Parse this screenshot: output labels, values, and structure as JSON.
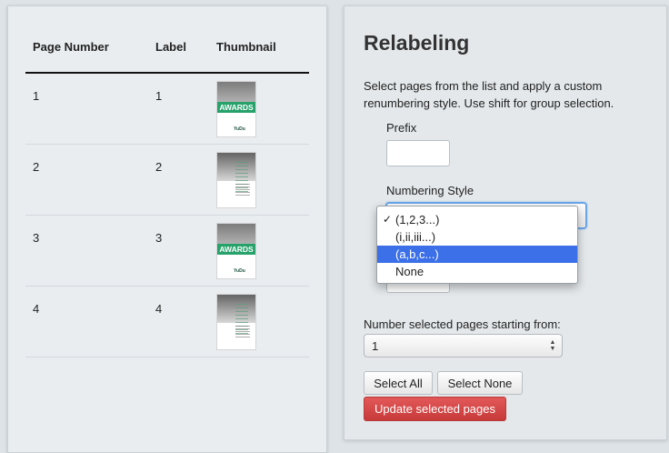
{
  "table": {
    "headers": {
      "page_number": "Page Number",
      "label": "Label",
      "thumbnail": "Thumbnail"
    },
    "rows": [
      {
        "page": "1",
        "label": "1",
        "thumb_text": "AWARDS",
        "thumb_brand": "YuDu",
        "thumb_style": "cover"
      },
      {
        "page": "2",
        "label": "2",
        "thumb_text": "",
        "thumb_brand": "",
        "thumb_style": "text"
      },
      {
        "page": "3",
        "label": "3",
        "thumb_text": "AWARDS",
        "thumb_brand": "YuDu",
        "thumb_style": "cover"
      },
      {
        "page": "4",
        "label": "4",
        "thumb_text": "",
        "thumb_brand": "",
        "thumb_style": "text"
      }
    ]
  },
  "relabel": {
    "title": "Relabeling",
    "description": "Select pages from the list and apply a custom renumbering style. Use shift for group selection.",
    "prefix_label": "Prefix",
    "prefix_value": "",
    "numbering_style_label": "Numbering Style",
    "numbering_style_options": [
      "(1,2,3...)",
      "(i,ii,iii...)",
      "(a,b,c...)",
      "None"
    ],
    "numbering_style_selected": "(1,2,3...)",
    "highlighted_option": "(a,b,c...)",
    "start_label": "Number selected pages starting from:",
    "start_value": "1",
    "select_all": "Select All",
    "select_none": "Select None",
    "update": "Update selected pages"
  },
  "colors": {
    "primary_button": "#d34545",
    "highlight": "#3c70e8",
    "thumb_band": "#27a26b"
  },
  "icons": {
    "checkmark": "check-icon",
    "select_arrows": "select-arrows-icon"
  }
}
